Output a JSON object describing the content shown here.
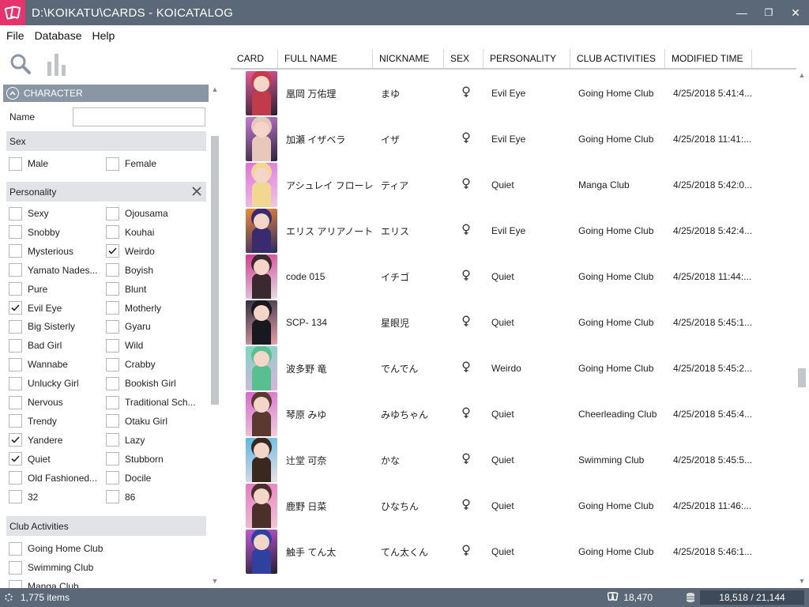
{
  "window": {
    "title": "D:\\KOIKATU\\CARDS - KOICATALOG",
    "minimize_glyph": "—",
    "maximize_glyph": "❐",
    "close_glyph": "✕"
  },
  "menu": [
    "File",
    "Database",
    "Help"
  ],
  "filter": {
    "section_title": "CHARACTER",
    "name_label": "Name",
    "name_value": "",
    "sex": {
      "title": "Sex",
      "options": [
        {
          "label": "Male",
          "checked": false
        },
        {
          "label": "Female",
          "checked": false
        }
      ]
    },
    "personality": {
      "title": "Personality",
      "options": [
        {
          "label": "Sexy",
          "checked": false
        },
        {
          "label": "Ojousama",
          "checked": false
        },
        {
          "label": "Snobby",
          "checked": false
        },
        {
          "label": "Kouhai",
          "checked": false
        },
        {
          "label": "Mysterious",
          "checked": false
        },
        {
          "label": "Weirdo",
          "checked": true
        },
        {
          "label": "Yamato Nades...",
          "checked": false
        },
        {
          "label": "Boyish",
          "checked": false
        },
        {
          "label": "Pure",
          "checked": false
        },
        {
          "label": "Blunt",
          "checked": false
        },
        {
          "label": "Evil Eye",
          "checked": true
        },
        {
          "label": "Motherly",
          "checked": false
        },
        {
          "label": "Big Sisterly",
          "checked": false
        },
        {
          "label": "Gyaru",
          "checked": false
        },
        {
          "label": "Bad Girl",
          "checked": false
        },
        {
          "label": "Wild",
          "checked": false
        },
        {
          "label": "Wannabe",
          "checked": false
        },
        {
          "label": "Crabby",
          "checked": false
        },
        {
          "label": "Unlucky Girl",
          "checked": false
        },
        {
          "label": "Bookish Girl",
          "checked": false
        },
        {
          "label": "Nervous",
          "checked": false
        },
        {
          "label": "Traditional Sch...",
          "checked": false
        },
        {
          "label": "Trendy",
          "checked": false
        },
        {
          "label": "Otaku Girl",
          "checked": false
        },
        {
          "label": "Yandere",
          "checked": true
        },
        {
          "label": "Lazy",
          "checked": false
        },
        {
          "label": "Quiet",
          "checked": true
        },
        {
          "label": "Stubborn",
          "checked": false
        },
        {
          "label": "Old Fashioned...",
          "checked": false
        },
        {
          "label": "Docile",
          "checked": false
        },
        {
          "label": "32",
          "checked": false
        },
        {
          "label": "86",
          "checked": false
        }
      ]
    },
    "club": {
      "title": "Club Activities",
      "options": [
        {
          "label": "Going Home Club",
          "checked": false
        },
        {
          "label": "Swimming Club",
          "checked": false
        },
        {
          "label": "Manga Club",
          "checked": false
        }
      ]
    }
  },
  "table": {
    "columns": [
      "CARD",
      "FULL NAME",
      "NICKNAME",
      "SEX",
      "PERSONALITY",
      "CLUB ACTIVITIES",
      "MODIFIED TIME"
    ],
    "rows": [
      {
        "full_name": "凰岡 万佑理",
        "nickname": "まゆ",
        "sex": "♀",
        "personality": "Evil Eye",
        "club": "Going Home Club",
        "modified": "4/25/2018 5:41:4...",
        "colors": [
          "#e85a9a",
          "#c23b4a",
          "#2a2030"
        ]
      },
      {
        "full_name": "加瀬 イザベラ",
        "nickname": "イザ",
        "sex": "♀",
        "personality": "Evil Eye",
        "club": "Going Home Club",
        "modified": "4/25/2018 11:41:...",
        "colors": [
          "#c77ad8",
          "#e8c8b8",
          "#2b2438"
        ]
      },
      {
        "full_name": "アシュレイ フローレイ...",
        "nickname": "ティア",
        "sex": "♀",
        "personality": "Quiet",
        "club": "Manga Club",
        "modified": "4/25/2018 5:42:0...",
        "colors": [
          "#e070e0",
          "#f0d890",
          "#f2c8e0"
        ]
      },
      {
        "full_name": "エリス アリアノート",
        "nickname": "エリス",
        "sex": "♀",
        "personality": "Evil Eye",
        "club": "Going Home Club",
        "modified": "4/25/2018 5:42:4...",
        "colors": [
          "#f08a3a",
          "#3a2a70",
          "#2a2a60"
        ]
      },
      {
        "full_name": "code 015",
        "nickname": "イチゴ",
        "sex": "♀",
        "personality": "Quiet",
        "club": "Going Home Club",
        "modified": "4/25/2018 11:44:...",
        "colors": [
          "#d83a8a",
          "#3a2a30",
          "#e0e0e8"
        ]
      },
      {
        "full_name": "SCP- 134",
        "nickname": "星眼児",
        "sex": "♀",
        "personality": "Quiet",
        "club": "Going Home Club",
        "modified": "4/25/2018 5:45:1...",
        "colors": [
          "#303040",
          "#181820",
          "#e8a0a8"
        ]
      },
      {
        "full_name": "波多野 竜",
        "nickname": "でんでん",
        "sex": "♀",
        "personality": "Weirdo",
        "club": "Going Home Club",
        "modified": "4/25/2018 5:45:2...",
        "colors": [
          "#7ad8c0",
          "#58c090",
          "#e0b0e0"
        ]
      },
      {
        "full_name": "琴原 みゆ",
        "nickname": "みゆちゃん",
        "sex": "♀",
        "personality": "Quiet",
        "club": "Cheerleading Club",
        "modified": "4/25/2018 5:45:4...",
        "colors": [
          "#d868d0",
          "#5a3a30",
          "#f0d0d8"
        ]
      },
      {
        "full_name": "辻堂 可奈",
        "nickname": "かな",
        "sex": "♀",
        "personality": "Quiet",
        "club": "Swimming Club",
        "modified": "4/25/2018 5:45:5...",
        "colors": [
          "#58b8e8",
          "#3a2820",
          "#f0e0e0"
        ]
      },
      {
        "full_name": "鹿野 日菜",
        "nickname": "ひなちん",
        "sex": "♀",
        "personality": "Quiet",
        "club": "Going Home Club",
        "modified": "4/25/2018 11:46:...",
        "colors": [
          "#e878c0",
          "#4a3028",
          "#f0c8d0"
        ]
      },
      {
        "full_name": "触手 てん太",
        "nickname": "てん太くん",
        "sex": "♀",
        "personality": "Quiet",
        "club": "Going Home Club",
        "modified": "4/25/2018 5:46:1...",
        "colors": [
          "#c858d8",
          "#3040a0",
          "#202030"
        ]
      }
    ]
  },
  "status": {
    "items": "1,775 items",
    "card_count": "18,470",
    "db_total": "18,518 / 21,144"
  },
  "colors": {
    "titlebar": "#5a6878",
    "accent": "#e6336b",
    "section": "#8a96a4"
  }
}
